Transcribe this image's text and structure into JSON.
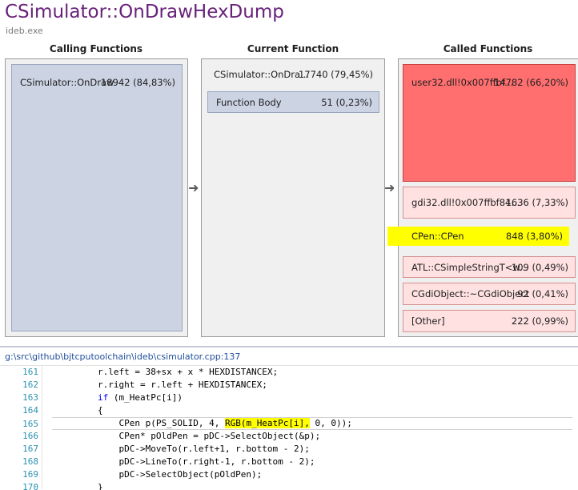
{
  "header": {
    "title": "CSimulator::OnDrawHexDump",
    "subtitle": "ideb.exe"
  },
  "calling": {
    "heading": "Calling Functions",
    "items": [
      {
        "label": "CSimulator::OnDraw",
        "value": "18942 (84,83%)"
      }
    ]
  },
  "current": {
    "heading": "Current Function",
    "name": "CSimulator::OnDra...",
    "value": "17740 (79,45%)",
    "body_label": "Function Body",
    "body_value": "51 (0,23%)"
  },
  "called": {
    "heading": "Called Functions",
    "items": [
      {
        "label": "user32.dll!0x007ffbf...",
        "value": "14782 (66,20%)"
      },
      {
        "label": "gdi32.dll!0x007ffbf84...",
        "value": "1636 (7,33%)"
      },
      {
        "label": "CPen::CPen",
        "value": "848 (3,80%)"
      },
      {
        "label": "ATL::CSimpleStringT<w...",
        "value": "109 (0,49%)"
      },
      {
        "label": "CGdiObject::~CGdiObject",
        "value": "92 (0,41%)"
      },
      {
        "label": "[Other]",
        "value": "222 (0,99%)"
      }
    ]
  },
  "arrows": {
    "glyph": "➜"
  },
  "source": {
    "path": "g:\\src\\github\\bjtcputoolchain\\ideb\\csimulator.cpp:137",
    "lines": [
      {
        "num": "161",
        "pre": "r.left = 38+sx + x * HEXDISTANCEX;",
        "kw": "",
        "hl": "",
        "post": ""
      },
      {
        "num": "162",
        "pre": "r.right = r.left + HEXDISTANCEX;",
        "kw": "",
        "hl": "",
        "post": ""
      },
      {
        "num": "163",
        "kw": "if",
        "pre": " (m_HeatPc[i])",
        "hl": "",
        "post": ""
      },
      {
        "num": "164",
        "pre": "{",
        "kw": "",
        "hl": "",
        "post": ""
      },
      {
        "num": "165",
        "pre": "    CPen p(PS_SOLID, 4, ",
        "kw": "",
        "hl": "RGB(m_HeatPc[i],",
        "post": " 0, 0));"
      },
      {
        "num": "166",
        "pre": "    CPen* pOldPen = pDC->SelectObject(&p);",
        "kw": "",
        "hl": "",
        "post": ""
      },
      {
        "num": "167",
        "pre": "    pDC->MoveTo(r.left+1, r.bottom - 2);",
        "kw": "",
        "hl": "",
        "post": ""
      },
      {
        "num": "168",
        "pre": "    pDC->LineTo(r.right-1, r.bottom - 2);",
        "kw": "",
        "hl": "",
        "post": ""
      },
      {
        "num": "169",
        "pre": "    pDC->SelectObject(pOldPen);",
        "kw": "",
        "hl": "",
        "post": ""
      },
      {
        "num": "170",
        "pre": "}",
        "kw": "",
        "hl": "",
        "post": ""
      }
    ]
  },
  "colors": {
    "title": "#68217a",
    "calling_fill": "#ccd3e3",
    "hot": "#ff6f6f",
    "warm": "#ffe1e1",
    "highlight": "#ffff00",
    "line_number": "#2b91af",
    "keyword": "#0000ff"
  }
}
